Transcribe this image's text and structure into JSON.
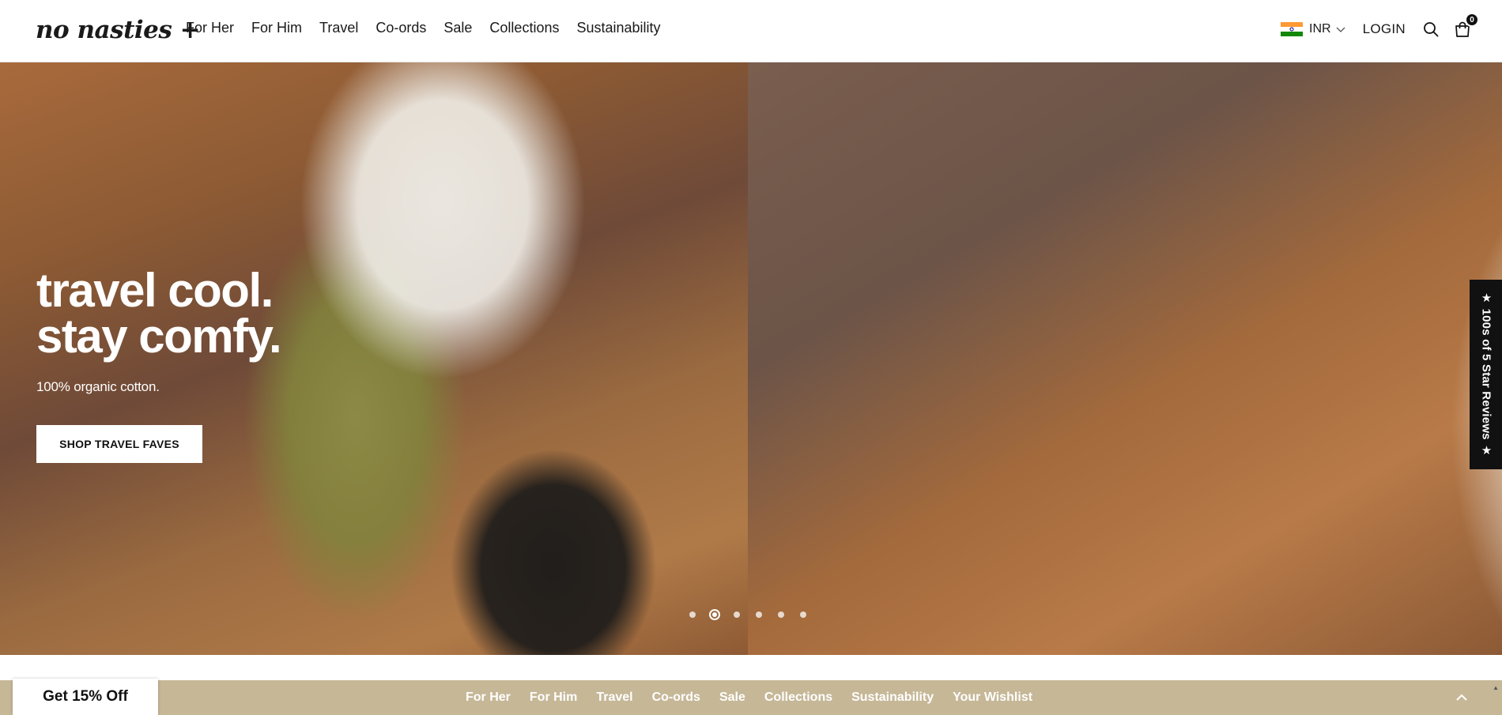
{
  "header": {
    "logo": "no nasties +",
    "nav": [
      "For Her",
      "For Him",
      "Travel",
      "Co-ords",
      "Sale",
      "Collections",
      "Sustainability"
    ],
    "currency": "INR",
    "login_label": "LOGIN",
    "cart_count": "0",
    "icons": {
      "search": "search-icon",
      "cart": "bag-icon",
      "currency_chevron": "chevron-down-icon"
    }
  },
  "hero": {
    "title_line1": "travel cool.",
    "title_line2": "stay comfy.",
    "subtitle": "100% organic cotton.",
    "cta_label": "SHOP TRAVEL FAVES",
    "slide_count": 6,
    "active_slide": 2
  },
  "reviews_tab": {
    "label": "★ 100s of 5 Star Reviews ★"
  },
  "bottom_bar": {
    "nav": [
      "For Her",
      "For Him",
      "Travel",
      "Co-ords",
      "Sale",
      "Collections",
      "Sustainability",
      "Your Wishlist"
    ],
    "discount_label": "Get 15% Off",
    "bar_color": "#c6b797"
  }
}
